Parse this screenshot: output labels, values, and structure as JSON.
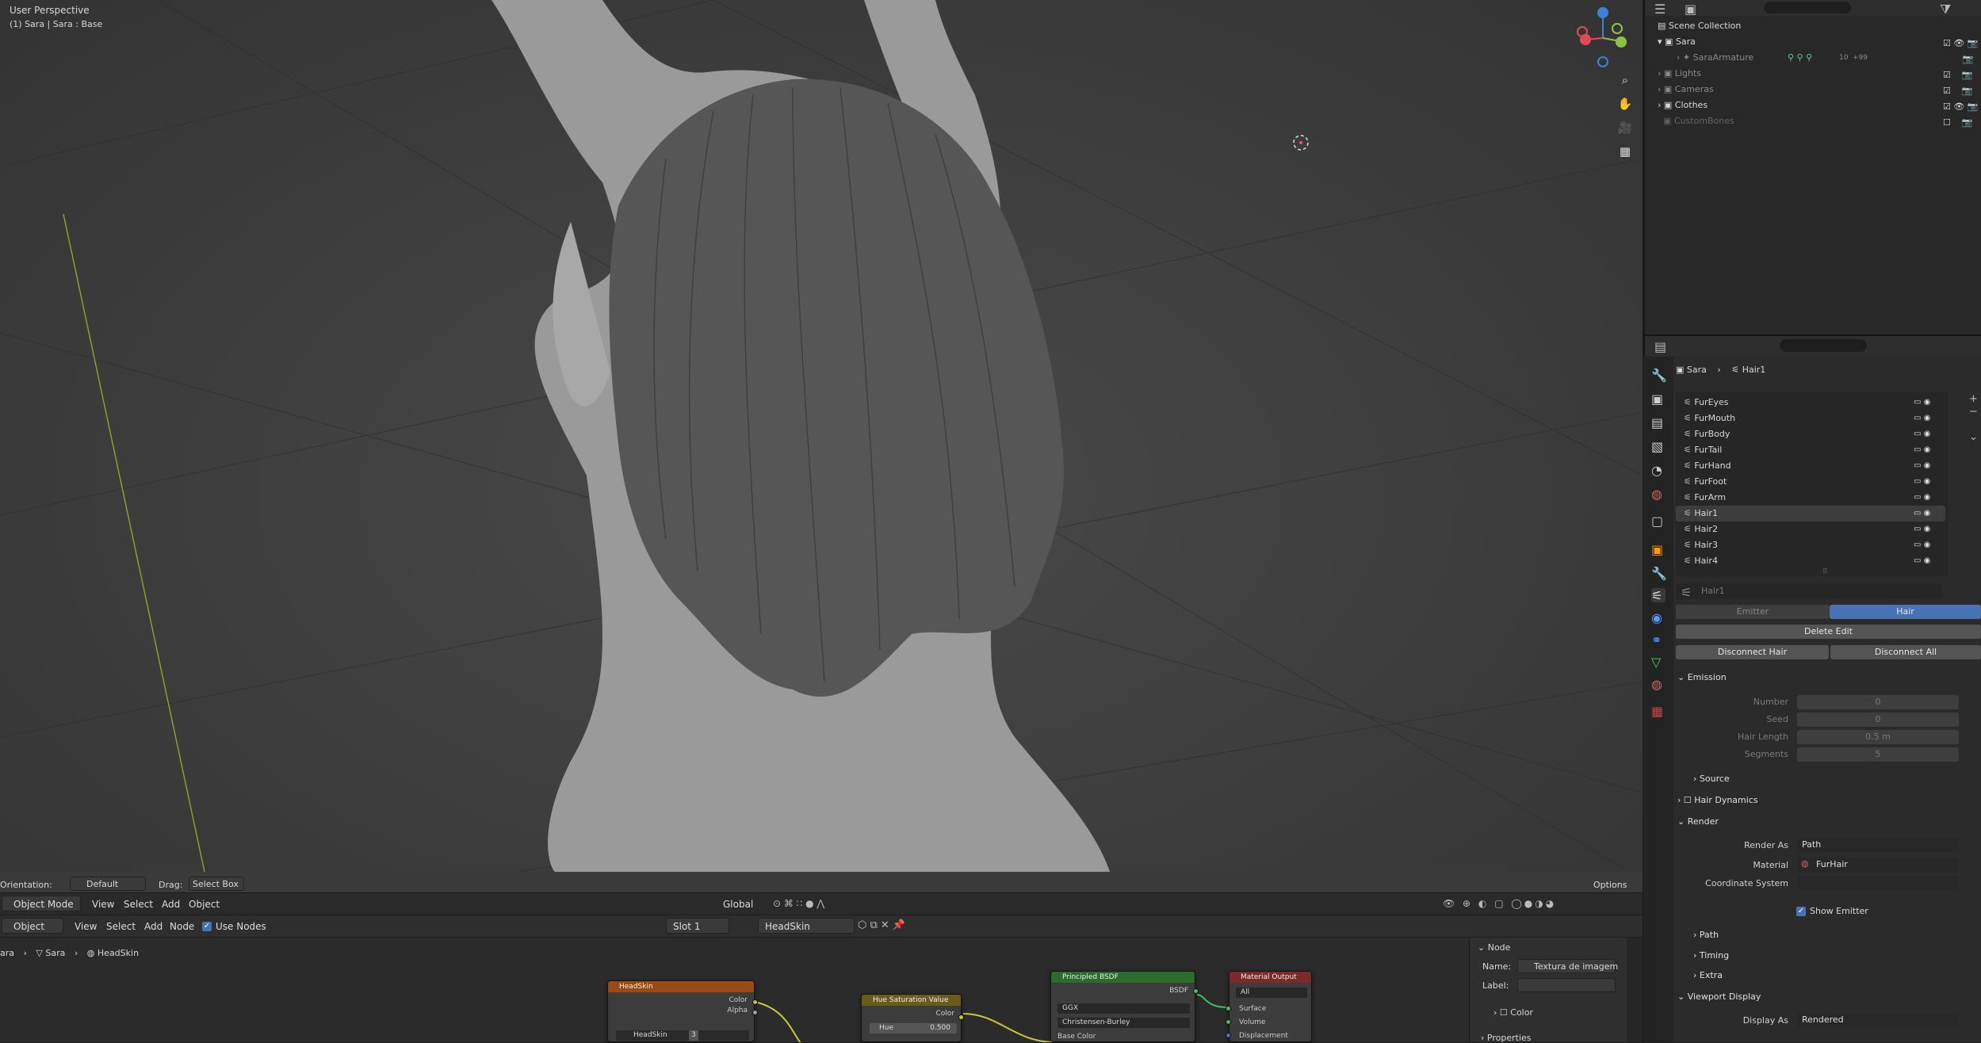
{
  "viewport": {
    "title": "User Perspective",
    "subtitle": "(1) Sara | Sara : Base",
    "header": {
      "orientation_label": "Orientation:",
      "orientation_value": "Default",
      "drag_label": "Drag:",
      "drag_value": "Select Box",
      "options": "Options",
      "mode": "Object Mode",
      "menus": [
        "View",
        "Select",
        "Add",
        "Object"
      ],
      "transform": "Global"
    }
  },
  "node_editor": {
    "type": "Object",
    "menus": [
      "View",
      "Select",
      "Add",
      "Node"
    ],
    "use_nodes": "Use Nodes",
    "slot": "Slot 1",
    "material": "HeadSkin",
    "breadcrumb": [
      "ara",
      "Sara",
      "HeadSkin"
    ],
    "nodes": {
      "headskin": {
        "title": "HeadSkin",
        "out1": "Color",
        "out2": "Alpha",
        "image": "HeadSkin",
        "users": "3"
      },
      "hsv": {
        "title": "Hue Saturation Value",
        "out": "Color",
        "hue_label": "Hue",
        "hue_value": "0.500"
      },
      "bsdf": {
        "title": "Principled BSDF",
        "out": "BSDF",
        "dist": "GGX",
        "sss": "Christensen-Burley",
        "base": "Base Color"
      },
      "output": {
        "title": "Material Output",
        "target": "All",
        "in1": "Surface",
        "in2": "Volume",
        "in3": "Displacement"
      }
    },
    "side_panel": {
      "section": "Node",
      "name_label": "Name:",
      "name_value": "Textura de imagem",
      "label_label": "Label:",
      "color": "Color",
      "properties": "Properties"
    }
  },
  "outliner": {
    "root": "Scene Collection",
    "items": [
      {
        "label": "Sara"
      },
      {
        "label": "SaraArmature",
        "badge": "10",
        "extra": "+99"
      },
      {
        "label": "Lights"
      },
      {
        "label": "Cameras"
      },
      {
        "label": "Clothes"
      },
      {
        "label": "CustomBones"
      }
    ]
  },
  "properties": {
    "breadcrumb": [
      "Sara",
      "Hair1"
    ],
    "systems": [
      "FurEyes",
      "FurMouth",
      "FurBody",
      "FurTail",
      "FurHand",
      "FurFoot",
      "FurArm",
      "Hair1",
      "Hair2",
      "Hair3",
      "Hair4"
    ],
    "selected_system": "Hair1",
    "settings_name": "Hair1",
    "type_tabs": [
      "Emitter",
      "Hair"
    ],
    "delete_edit": "Delete Edit",
    "disconnect_hair": "Disconnect Hair",
    "disconnect_all": "Disconnect All",
    "emission": {
      "title": "Emission",
      "fields": [
        {
          "label": "Number",
          "value": "0"
        },
        {
          "label": "Seed",
          "value": "0"
        },
        {
          "label": "Hair Length",
          "value": "0.5 m"
        },
        {
          "label": "Segments",
          "value": "5"
        }
      ]
    },
    "source": "Source",
    "hair_dynamics": "Hair Dynamics",
    "render": {
      "title": "Render",
      "render_as_label": "Render As",
      "render_as": "Path",
      "material_label": "Material",
      "material": "FurHair",
      "coord_label": "Coordinate System",
      "show_emitter": "Show Emitter",
      "path": "Path",
      "timing": "Timing",
      "extra": "Extra"
    },
    "viewport_display": {
      "title": "Viewport Display",
      "display_as_label": "Display As",
      "display_as": "Rendered"
    }
  },
  "colors": {
    "accent": "#4772b3",
    "image_node": "#9c4a13",
    "hsv_node": "#6b5a1a",
    "bsdf_node": "#2d6a2d",
    "output_node": "#7a2a2a",
    "x_axis": "#e24a5b",
    "y_axis": "#8bc34a",
    "z_axis": "#3f7fd6"
  }
}
